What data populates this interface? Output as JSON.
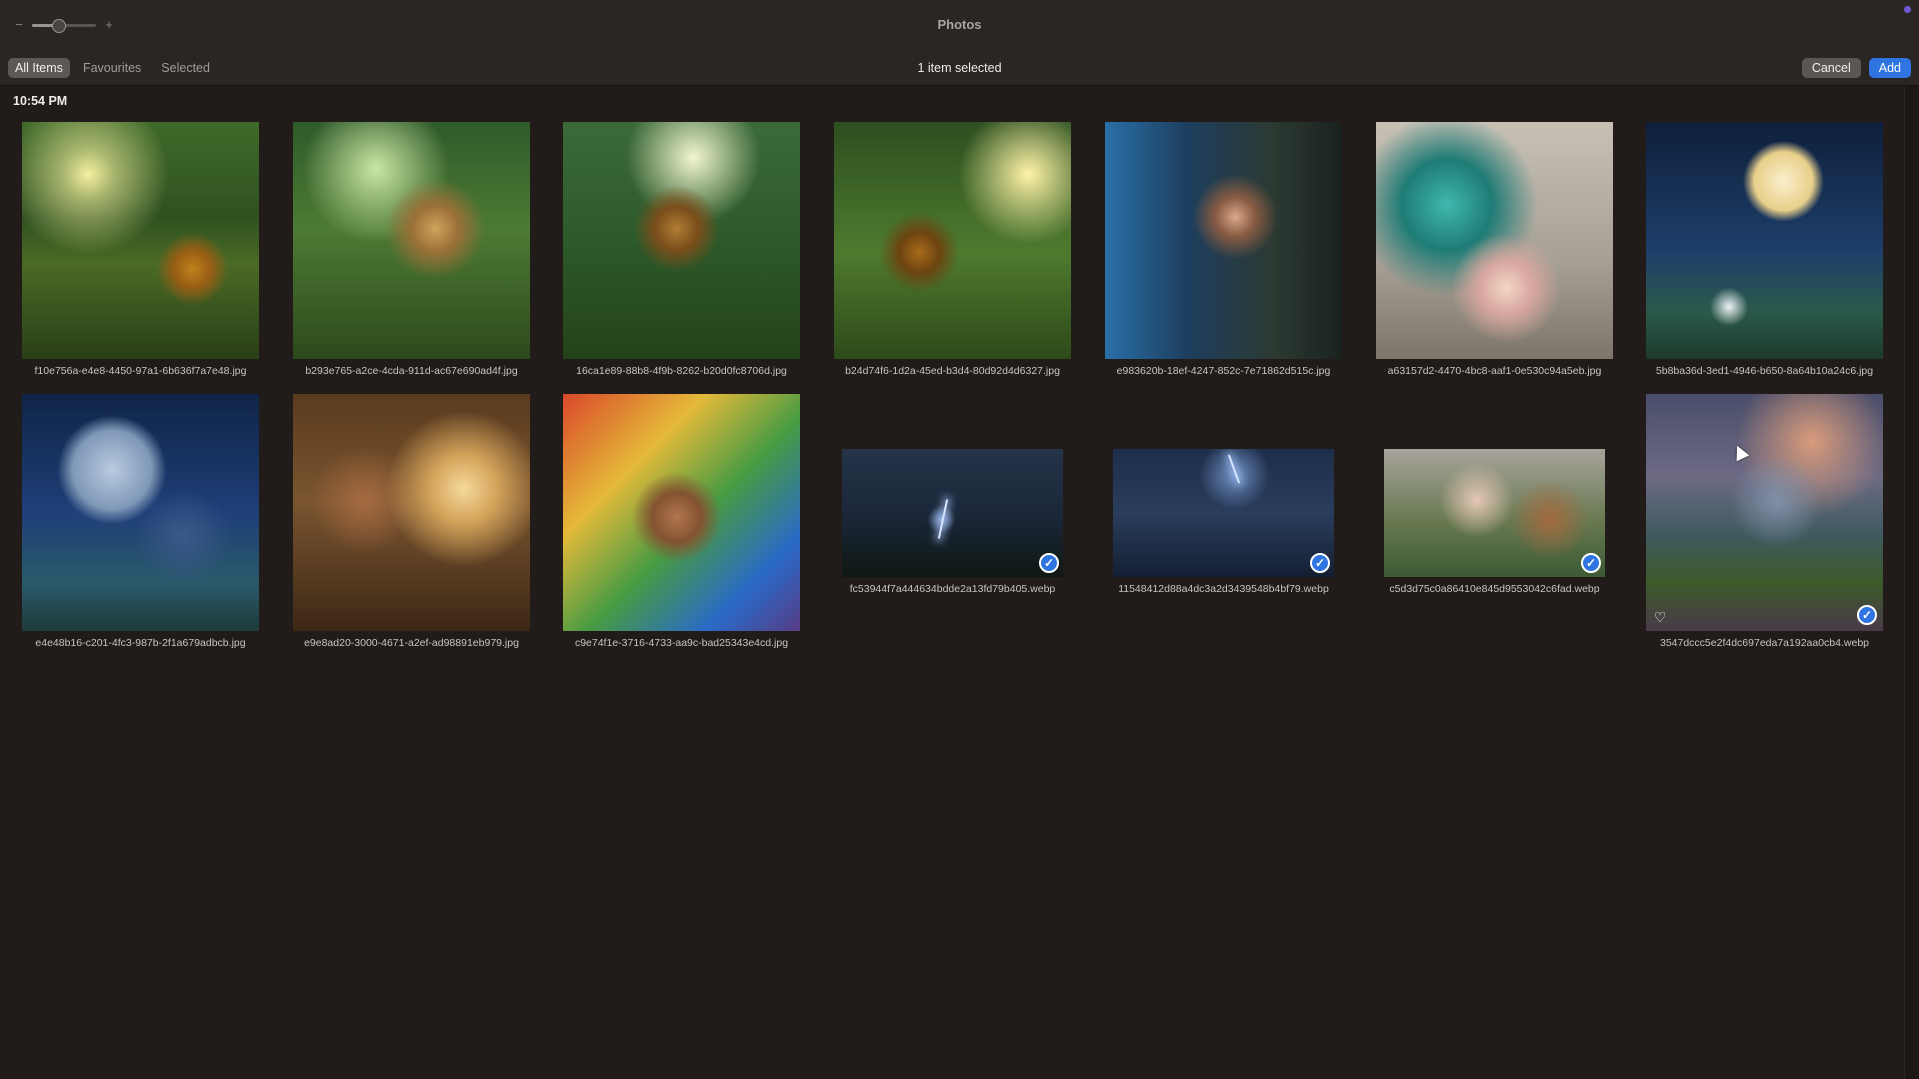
{
  "window": {
    "title": "Photos",
    "zoom_level": 0.4
  },
  "toolbar": {
    "tabs": [
      {
        "label": "All Items",
        "active": true
      },
      {
        "label": "Favourites",
        "active": false
      },
      {
        "label": "Selected",
        "active": false
      }
    ],
    "selection_status": "1 item selected",
    "cancel_label": "Cancel",
    "add_label": "Add"
  },
  "library": {
    "date_header": "10:54 PM",
    "photos": [
      {
        "filename": "f10e756a-e4e8-4450-97a1-6b636f7a7e48.jpg",
        "art": "art-forest1",
        "shape": "square",
        "selected": false,
        "favourite": false
      },
      {
        "filename": "b293e765-a2ce-4cda-911d-ac67e690ad4f.jpg",
        "art": "art-forest2",
        "shape": "square",
        "selected": false,
        "favourite": false
      },
      {
        "filename": "16ca1e89-88b8-4f9b-8262-b20d0fc8706d.jpg",
        "art": "art-forest3",
        "shape": "square",
        "selected": false,
        "favourite": false
      },
      {
        "filename": "b24d74f6-1d2a-45ed-b3d4-80d92d4d6327.jpg",
        "art": "art-forest4",
        "shape": "square",
        "selected": false,
        "favourite": false
      },
      {
        "filename": "e983620b-18ef-4247-852c-7e71862d515c.jpg",
        "art": "art-gamer",
        "shape": "square",
        "selected": false,
        "favourite": false
      },
      {
        "filename": "a63157d2-4470-4bc8-aaf1-0e530c94a5eb.jpg",
        "art": "art-jesus",
        "shape": "square",
        "selected": false,
        "favourite": false
      },
      {
        "filename": "5b8ba36d-3ed1-4946-b650-8a64b10a24c6.jpg",
        "art": "art-moonrabbit",
        "shape": "square",
        "selected": false,
        "favourite": false
      },
      {
        "filename": "e4e48b16-c201-4fc3-987b-2f1a679adbcb.jpg",
        "art": "art-moonblue",
        "shape": "square",
        "selected": false,
        "favourite": false
      },
      {
        "filename": "e9e8ad20-3000-4671-a2ef-ad98891eb979.jpg",
        "art": "art-hut",
        "shape": "square",
        "selected": false,
        "favourite": false
      },
      {
        "filename": "c9e74f1e-3716-4733-aa9c-bad25343e4cd.jpg",
        "art": "art-kite",
        "shape": "square",
        "selected": false,
        "favourite": false
      },
      {
        "filename": "fc53944f7a444634bdde2a13fd79b405.webp",
        "art": "art-storm",
        "shape": "wide",
        "selected": true,
        "favourite": false
      },
      {
        "filename": "11548412d88a4dc3a2d3439548b4bf79.webp",
        "art": "art-city",
        "shape": "wide",
        "selected": true,
        "favourite": false
      },
      {
        "filename": "c5d3d75c0a86410e845d9553042c6fad.webp",
        "art": "art-lovers",
        "shape": "wide",
        "selected": true,
        "favourite": false
      },
      {
        "filename": "3547dccc5e2f4dc697eda7a192aa0cb4.webp",
        "art": "art-mountain",
        "shape": "square",
        "selected": true,
        "favourite": true
      }
    ]
  },
  "icons": {
    "check": "✓",
    "heart": "♡",
    "minus": "−",
    "plus": "+"
  }
}
